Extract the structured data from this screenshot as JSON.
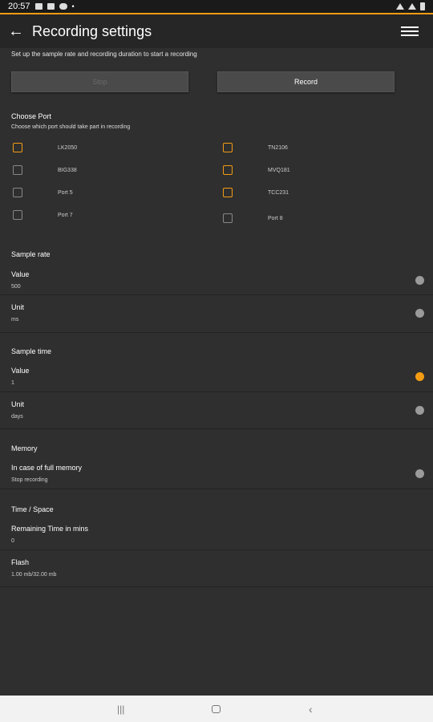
{
  "status_bar": {
    "time": "20:57"
  },
  "app_bar": {
    "title": "Recording settings"
  },
  "intro": {
    "hint": "Set up the sample rate and recording duration to start a recording"
  },
  "buttons": {
    "stop_label": "Stop",
    "record_label": "Record"
  },
  "ports": {
    "title": "Choose Port",
    "subtitle": "Choose which port should take part in recording",
    "left": [
      {
        "label": "LK2050",
        "checked": true
      },
      {
        "label": "BIG338",
        "checked": false
      },
      {
        "label": "Port 5",
        "checked": false
      },
      {
        "label": "Port 7",
        "checked": false
      }
    ],
    "right": [
      {
        "label": "TN2106",
        "checked": true
      },
      {
        "label": "MVQ181",
        "checked": true
      },
      {
        "label": "TCC231",
        "checked": true
      },
      {
        "label": "Port 8",
        "checked": false
      }
    ]
  },
  "sample_rate": {
    "title": "Sample rate",
    "value_label": "Value",
    "value": "500",
    "unit_label": "Unit",
    "unit": "ms"
  },
  "sample_time": {
    "title": "Sample time",
    "value_label": "Value",
    "value": "1",
    "unit_label": "Unit",
    "unit": "days"
  },
  "memory": {
    "title": "Memory",
    "full_label": "In case of full memory",
    "full_value": "Stop recording"
  },
  "time_space": {
    "title": "Time / Space",
    "remaining_label": "Remaining Time in mins",
    "remaining_value": "0",
    "flash_label": "Flash",
    "flash_value": "1.00 mb/32.00 mb"
  },
  "colors": {
    "accent": "#f39c12",
    "background": "#2f2f2f",
    "appbar": "#262626"
  }
}
